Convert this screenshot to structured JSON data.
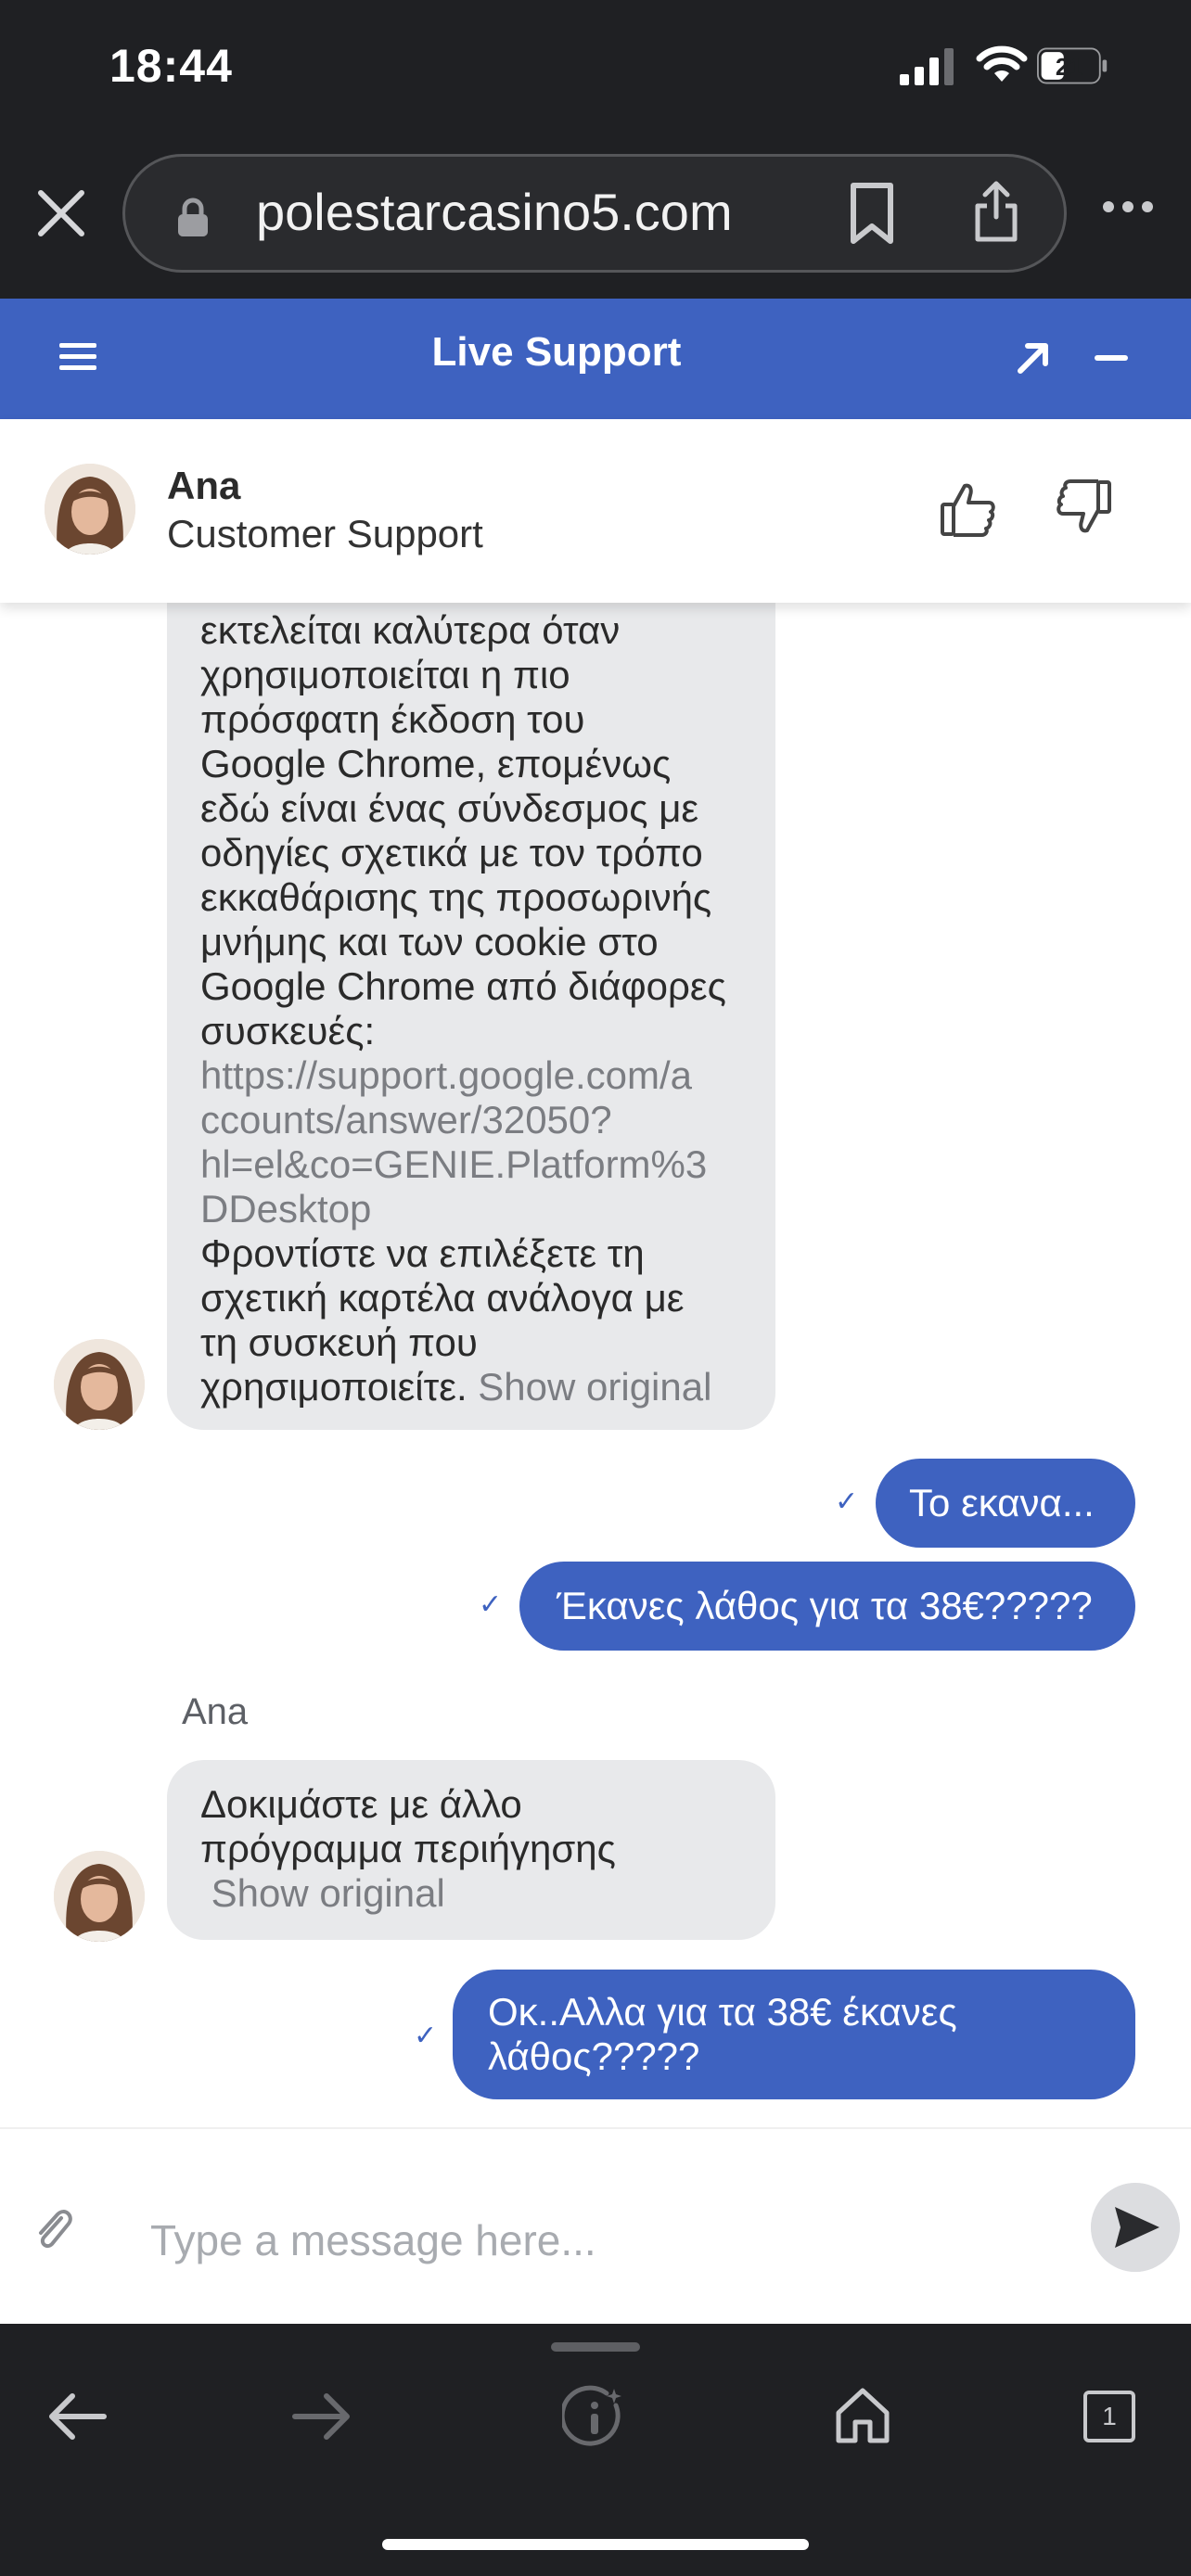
{
  "status": {
    "time": "18:44",
    "battery": "21"
  },
  "browser": {
    "url": "polestarcasino5.com"
  },
  "header": {
    "title": "Live Support"
  },
  "agent": {
    "name": "Ana",
    "role": "Customer Support"
  },
  "messages": {
    "m1_lines": [
      "εκτελείται καλύτερα όταν",
      "χρησιμοποιείται η πιο",
      "πρόσφατη έκδοση του",
      "Google Chrome, επομένως",
      "εδώ είναι ένας σύνδεσμος με",
      "οδηγίες σχετικά με τον τρόπο",
      "εκκαθάρισης της προσωρινής",
      "μνήμης και των cookie στο",
      "Google Chrome από διάφορες",
      "συσκευές:"
    ],
    "m1_link_lines": [
      "https://support.google.com/a",
      "ccounts/answer/32050?",
      "hl=el&co=GENIE.Platform%3",
      "DDesktop"
    ],
    "m1_tail_lines": [
      "Φροντίστε να επιλέξετε τη",
      "σχετική καρτέλα ανάλογα με",
      "τη συσκευή που"
    ],
    "m1_last": "χρησιμοποιείτε.",
    "show_original": "Show original",
    "m2": "Το εκανα...",
    "m3": "Έκανες λάθος για τα 38€?????",
    "sender_label": "Ana",
    "m4_lines": [
      "Δοκιμάστε με άλλο",
      "πρόγραμμα περιήγησης"
    ],
    "m5_lines": [
      "Οκ..Αλλα για τα 38€ έκανες",
      "λάθος?????"
    ],
    "tick": "✓"
  },
  "composer": {
    "placeholder": "Type a message here..."
  },
  "bottom": {
    "tabs_count": "1"
  },
  "colors": {
    "accent": "#3e62c0",
    "bubble_in": "#e8e9eb",
    "chrome": "#1f2023"
  }
}
